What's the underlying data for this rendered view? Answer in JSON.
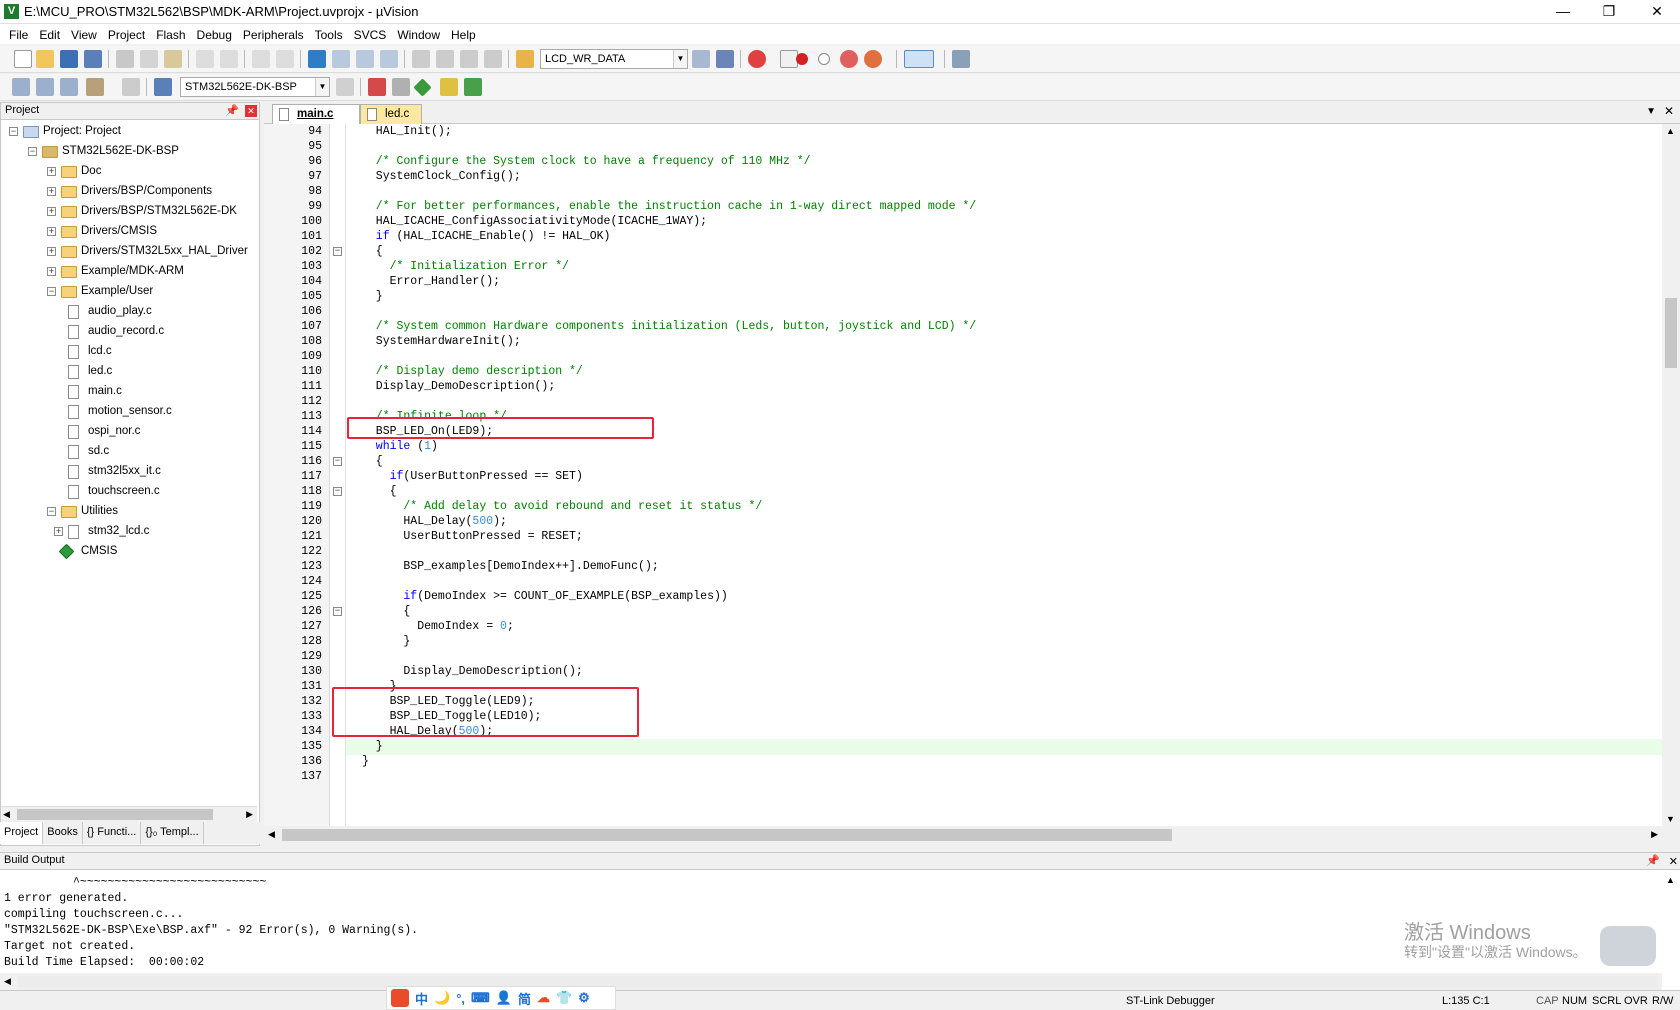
{
  "window": {
    "title": "E:\\MCU_PRO\\STM32L562\\BSP\\MDK-ARM\\Project.uvprojx - µVision",
    "minimize": "—",
    "restore": "❐",
    "close": "✕",
    "app_icon": "V"
  },
  "menu": [
    "File",
    "Edit",
    "View",
    "Project",
    "Flash",
    "Debug",
    "Peripherals",
    "Tools",
    "SVCS",
    "Window",
    "Help"
  ],
  "toolbar1": {
    "find_combo": "LCD_WR_DATA"
  },
  "toolbar2": {
    "target_combo": "STM32L562E-DK-BSP"
  },
  "project_panel": {
    "title": "Project",
    "tree": [
      {
        "label": "Project: Project",
        "depth": 0,
        "kind": "root",
        "expander": "−"
      },
      {
        "label": "STM32L562E-DK-BSP",
        "depth": 1,
        "kind": "target",
        "expander": "−"
      },
      {
        "label": "Doc",
        "depth": 2,
        "kind": "folder",
        "expander": "+"
      },
      {
        "label": "Drivers/BSP/Components",
        "depth": 2,
        "kind": "folder",
        "expander": "+"
      },
      {
        "label": "Drivers/BSP/STM32L562E-DK",
        "depth": 2,
        "kind": "folder",
        "expander": "+"
      },
      {
        "label": "Drivers/CMSIS",
        "depth": 2,
        "kind": "folder",
        "expander": "+"
      },
      {
        "label": "Drivers/STM32L5xx_HAL_Driver",
        "depth": 2,
        "kind": "folder",
        "expander": "+"
      },
      {
        "label": "Example/MDK-ARM",
        "depth": 2,
        "kind": "folder",
        "expander": "+"
      },
      {
        "label": "Example/User",
        "depth": 2,
        "kind": "folder",
        "expander": "−"
      },
      {
        "label": "audio_play.c",
        "depth": 3,
        "kind": "file",
        "expander": ""
      },
      {
        "label": "audio_record.c",
        "depth": 3,
        "kind": "file",
        "expander": ""
      },
      {
        "label": "lcd.c",
        "depth": 3,
        "kind": "file",
        "expander": ""
      },
      {
        "label": "led.c",
        "depth": 3,
        "kind": "file",
        "expander": ""
      },
      {
        "label": "main.c",
        "depth": 3,
        "kind": "file",
        "expander": ""
      },
      {
        "label": "motion_sensor.c",
        "depth": 3,
        "kind": "file",
        "expander": ""
      },
      {
        "label": "ospi_nor.c",
        "depth": 3,
        "kind": "file",
        "expander": ""
      },
      {
        "label": "sd.c",
        "depth": 3,
        "kind": "file",
        "expander": ""
      },
      {
        "label": "stm32l5xx_it.c",
        "depth": 3,
        "kind": "file",
        "expander": ""
      },
      {
        "label": "touchscreen.c",
        "depth": 3,
        "kind": "file",
        "expander": ""
      },
      {
        "label": "Utilities",
        "depth": 2,
        "kind": "folder",
        "expander": "−"
      },
      {
        "label": "stm32_lcd.c",
        "depth": 3,
        "kind": "file",
        "expander": "+"
      },
      {
        "label": "CMSIS",
        "depth": 2,
        "kind": "cmsis",
        "expander": ""
      }
    ],
    "tabs": [
      "Project",
      "Books",
      "{} Functi...",
      "{}₀ Templ..."
    ]
  },
  "editor": {
    "tabs": [
      {
        "label": "main.c",
        "active": true
      },
      {
        "label": "led.c",
        "active": false
      }
    ],
    "lines": [
      {
        "n": "94",
        "parts": [
          [
            "",
            "  HAL_Init();"
          ]
        ]
      },
      {
        "n": "95",
        "parts": [
          [
            "",
            ""
          ]
        ]
      },
      {
        "n": "96",
        "parts": [
          [
            "cm",
            "  /* Configure the System clock to have a frequency of 110 MHz */"
          ]
        ]
      },
      {
        "n": "97",
        "parts": [
          [
            "",
            "  SystemClock_Config();"
          ]
        ]
      },
      {
        "n": "98",
        "parts": [
          [
            "",
            ""
          ]
        ]
      },
      {
        "n": "99",
        "parts": [
          [
            "cm",
            "  /* For better performances, enable the instruction cache in 1-way direct mapped mode */"
          ]
        ]
      },
      {
        "n": "100",
        "parts": [
          [
            "",
            "  HAL_ICACHE_ConfigAssociativityMode(ICACHE_1WAY);"
          ]
        ]
      },
      {
        "n": "101",
        "parts": [
          [
            "kw",
            "  if"
          ],
          [
            "",
            " (HAL_ICACHE_Enable() != HAL_OK)"
          ]
        ]
      },
      {
        "n": "102",
        "parts": [
          [
            "",
            "  {"
          ]
        ]
      },
      {
        "n": "103",
        "parts": [
          [
            "cm",
            "    /* Initialization Error */"
          ]
        ]
      },
      {
        "n": "104",
        "parts": [
          [
            "",
            "    Error_Handler();"
          ]
        ]
      },
      {
        "n": "105",
        "parts": [
          [
            "",
            "  }"
          ]
        ]
      },
      {
        "n": "106",
        "parts": [
          [
            "",
            ""
          ]
        ]
      },
      {
        "n": "107",
        "parts": [
          [
            "cm",
            "  /* System common Hardware components initialization (Leds, button, joystick and LCD) */"
          ]
        ]
      },
      {
        "n": "108",
        "parts": [
          [
            "",
            "  SystemHardwareInit();"
          ]
        ]
      },
      {
        "n": "109",
        "parts": [
          [
            "",
            ""
          ]
        ]
      },
      {
        "n": "110",
        "parts": [
          [
            "cm",
            "  /* Display demo description */"
          ]
        ]
      },
      {
        "n": "111",
        "parts": [
          [
            "",
            "  Display_DemoDescription();"
          ]
        ]
      },
      {
        "n": "112",
        "parts": [
          [
            "",
            ""
          ]
        ]
      },
      {
        "n": "113",
        "parts": [
          [
            "cm",
            "  /* Infinite loop */"
          ]
        ]
      },
      {
        "n": "114",
        "parts": [
          [
            "",
            "  BSP_LED_On(LED9);"
          ]
        ]
      },
      {
        "n": "115",
        "parts": [
          [
            "kw",
            "  while"
          ],
          [
            "",
            " ("
          ],
          [
            "nm",
            "1"
          ],
          [
            "",
            ")"
          ]
        ]
      },
      {
        "n": "116",
        "parts": [
          [
            "",
            "  {"
          ]
        ]
      },
      {
        "n": "117",
        "parts": [
          [
            "kw",
            "    if"
          ],
          [
            "",
            "(UserButtonPressed == SET)"
          ]
        ]
      },
      {
        "n": "118",
        "parts": [
          [
            "",
            "    {"
          ]
        ]
      },
      {
        "n": "119",
        "parts": [
          [
            "cm",
            "      /* Add delay to avoid rebound and reset it status */"
          ]
        ]
      },
      {
        "n": "120",
        "parts": [
          [
            "",
            "      HAL_Delay("
          ],
          [
            "nm",
            "500"
          ],
          [
            "",
            ");"
          ]
        ]
      },
      {
        "n": "121",
        "parts": [
          [
            "",
            "      UserButtonPressed = RESET;"
          ]
        ]
      },
      {
        "n": "122",
        "parts": [
          [
            "",
            ""
          ]
        ]
      },
      {
        "n": "123",
        "parts": [
          [
            "",
            "      BSP_examples[DemoIndex++].DemoFunc();"
          ]
        ]
      },
      {
        "n": "124",
        "parts": [
          [
            "",
            ""
          ]
        ]
      },
      {
        "n": "125",
        "parts": [
          [
            "kw",
            "      if"
          ],
          [
            "",
            "(DemoIndex >= COUNT_OF_EXAMPLE(BSP_examples))"
          ]
        ]
      },
      {
        "n": "126",
        "parts": [
          [
            "",
            "      {"
          ]
        ]
      },
      {
        "n": "127",
        "parts": [
          [
            "",
            "        DemoIndex = "
          ],
          [
            "nm",
            "0"
          ],
          [
            "",
            ";"
          ]
        ]
      },
      {
        "n": "128",
        "parts": [
          [
            "",
            "      }"
          ]
        ]
      },
      {
        "n": "129",
        "parts": [
          [
            "",
            ""
          ]
        ]
      },
      {
        "n": "130",
        "parts": [
          [
            "",
            "      Display_DemoDescription();"
          ]
        ]
      },
      {
        "n": "131",
        "parts": [
          [
            "",
            "    }"
          ]
        ]
      },
      {
        "n": "132",
        "parts": [
          [
            "",
            "    BSP_LED_Toggle(LED9);"
          ]
        ]
      },
      {
        "n": "133",
        "parts": [
          [
            "",
            "    BSP_LED_Toggle(LED10);"
          ]
        ]
      },
      {
        "n": "134",
        "parts": [
          [
            "",
            "    HAL_Delay("
          ],
          [
            "nm",
            "500"
          ],
          [
            "",
            ");"
          ]
        ]
      },
      {
        "n": "135",
        "parts": [
          [
            "",
            "  }"
          ]
        ]
      },
      {
        "n": "136",
        "parts": [
          [
            "",
            "}"
          ]
        ]
      },
      {
        "n": "137",
        "parts": [
          [
            "",
            ""
          ]
        ]
      }
    ]
  },
  "build_output": {
    "title": "Build Output",
    "lines": [
      "          ^~~~~~~~~~~~~~~~~~~~~~~~~~~~",
      "1 error generated.",
      "compiling touchscreen.c...",
      "\"STM32L562E-DK-BSP\\Exe\\BSP.axf\" - 92 Error(s), 0 Warning(s).",
      "Target not created.",
      "Build Time Elapsed:  00:00:02"
    ]
  },
  "watermark": {
    "line1": "激活 Windows",
    "line2": "转到\"设置\"以激活 Windows。"
  },
  "ime": [
    "中",
    "🌙",
    "°,",
    "⌨",
    "👤",
    "简",
    "☁",
    "👕",
    "⚙"
  ],
  "status": {
    "debugger": "ST-Link Debugger",
    "position": "L:135 C:1",
    "cap": "CAP",
    "num": "NUM",
    "scrl": "SCRL",
    "ovr": "OVR",
    "rw": "R/W"
  }
}
